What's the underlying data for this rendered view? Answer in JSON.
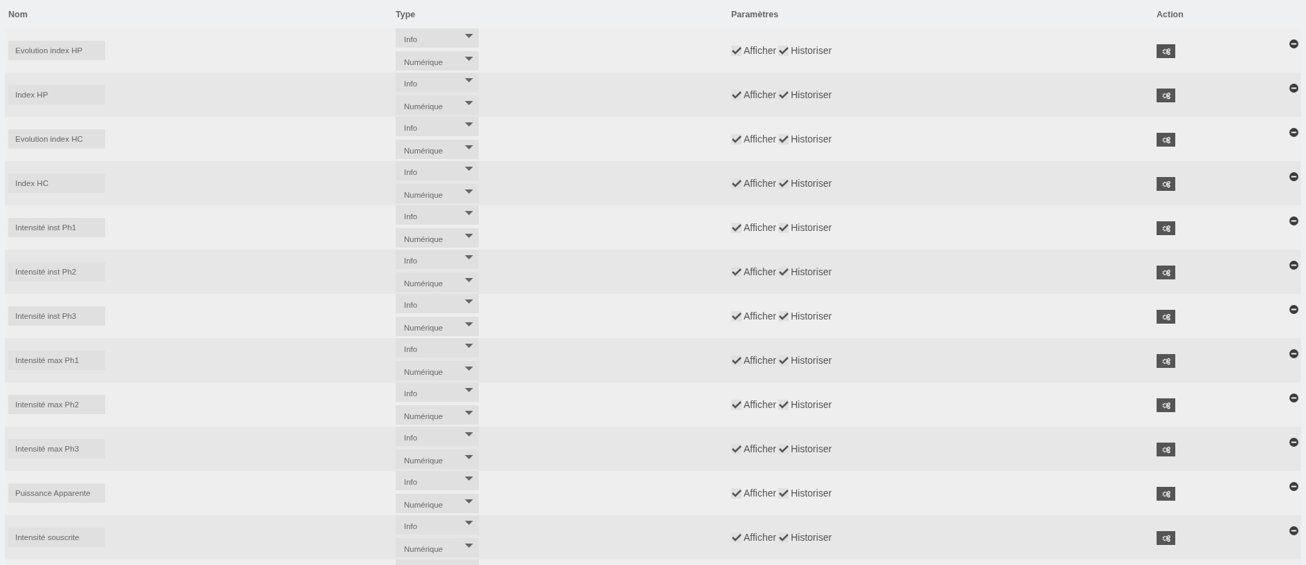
{
  "table": {
    "columns": [
      "Nom",
      "Type",
      "Paramètres",
      "Action"
    ],
    "rows": [
      {
        "name": "Evolution index HP",
        "type": "Info",
        "subtype": "Numérique",
        "afficher": {
          "label": "Afficher",
          "checked": true
        },
        "historiser": {
          "label": "Historiser",
          "checked": true
        }
      },
      {
        "name": "Index HP",
        "type": "Info",
        "subtype": "Numérique",
        "afficher": {
          "label": "Afficher",
          "checked": true
        },
        "historiser": {
          "label": "Historiser",
          "checked": true
        }
      },
      {
        "name": "Evolution index HC",
        "type": "Info",
        "subtype": "Numérique",
        "afficher": {
          "label": "Afficher",
          "checked": true
        },
        "historiser": {
          "label": "Historiser",
          "checked": true
        }
      },
      {
        "name": "Index HC",
        "type": "Info",
        "subtype": "Numérique",
        "afficher": {
          "label": "Afficher",
          "checked": true
        },
        "historiser": {
          "label": "Historiser",
          "checked": true
        }
      },
      {
        "name": "Intensité inst Ph1",
        "type": "Info",
        "subtype": "Numérique",
        "afficher": {
          "label": "Afficher",
          "checked": true
        },
        "historiser": {
          "label": "Historiser",
          "checked": true
        }
      },
      {
        "name": "Intensité inst Ph2",
        "type": "Info",
        "subtype": "Numérique",
        "afficher": {
          "label": "Afficher",
          "checked": true
        },
        "historiser": {
          "label": "Historiser",
          "checked": true
        }
      },
      {
        "name": "Intensité inst Ph3",
        "type": "Info",
        "subtype": "Numérique",
        "afficher": {
          "label": "Afficher",
          "checked": true
        },
        "historiser": {
          "label": "Historiser",
          "checked": true
        }
      },
      {
        "name": "Intensité max Ph1",
        "type": "Info",
        "subtype": "Numérique",
        "afficher": {
          "label": "Afficher",
          "checked": true
        },
        "historiser": {
          "label": "Historiser",
          "checked": true
        }
      },
      {
        "name": "Intensité max Ph2",
        "type": "Info",
        "subtype": "Numérique",
        "afficher": {
          "label": "Afficher",
          "checked": true
        },
        "historiser": {
          "label": "Historiser",
          "checked": true
        }
      },
      {
        "name": "Intensité max Ph3",
        "type": "Info",
        "subtype": "Numérique",
        "afficher": {
          "label": "Afficher",
          "checked": true
        },
        "historiser": {
          "label": "Historiser",
          "checked": true
        }
      },
      {
        "name": "Puissance Apparente",
        "type": "Info",
        "subtype": "Numérique",
        "afficher": {
          "label": "Afficher",
          "checked": true
        },
        "historiser": {
          "label": "Historiser",
          "checked": true
        }
      },
      {
        "name": "Intensité souscrite",
        "type": "Info",
        "subtype": "Numérique",
        "afficher": {
          "label": "Afficher",
          "checked": true
        },
        "historiser": {
          "label": "Historiser",
          "checked": true
        }
      }
    ]
  }
}
